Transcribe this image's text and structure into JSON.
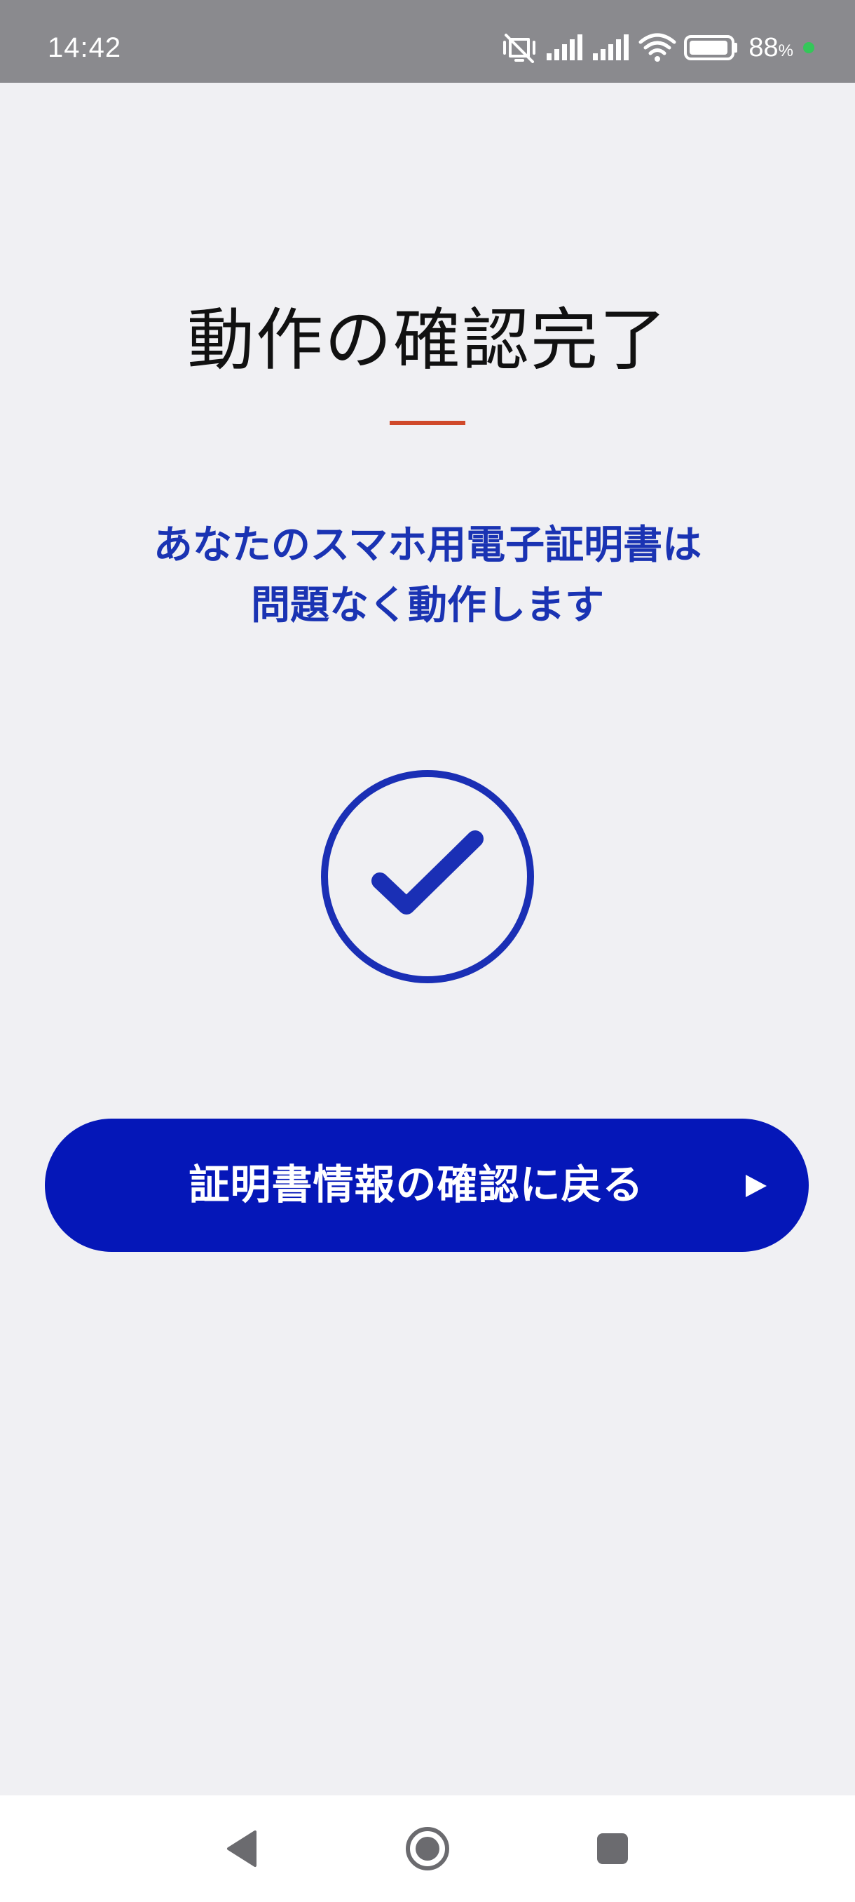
{
  "status_bar": {
    "time": "14:42",
    "battery_percent": "88",
    "battery_unit": "%",
    "icons": [
      "vibrate-off-icon",
      "signal-icon",
      "signal-icon",
      "wifi-icon",
      "battery-icon",
      "charging-dot"
    ]
  },
  "screen": {
    "title": "動作の確認完了",
    "message_line1": "あなたのスマホ用電子証明書は",
    "message_line2": "問題なく動作します",
    "status_icon": "check-circle-icon",
    "button_label": "証明書情報の確認に戻る",
    "button_icon": "play-arrow-icon"
  },
  "nav_bar": {
    "items": [
      "back-icon",
      "home-icon",
      "recents-icon"
    ]
  },
  "colors": {
    "accent": "#0517b8",
    "message_text": "#1a33b3",
    "underline": "#d0492a",
    "background": "#f0f0f3",
    "status_bar": "#8a8a8e"
  }
}
